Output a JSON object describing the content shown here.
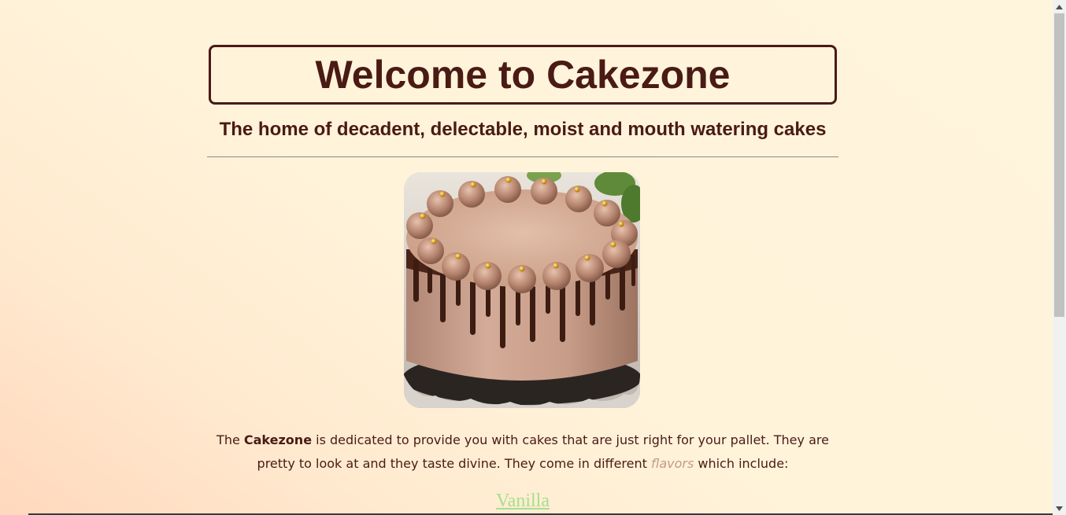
{
  "header": {
    "title": "Welcome to Cakezone",
    "subtitle": "The home of decadent, delectable, moist and mouth watering cakes"
  },
  "hero": {
    "image_alt": "Chocolate drip cake with piped frosting swirls and gold pearls"
  },
  "intro": {
    "text_1": "The ",
    "brand": "Cakezone",
    "text_2": " is dedicated to provide you with cakes that are just right for your pallet. They are pretty to look at and they taste divine. They come in different ",
    "flavors_word": "flavors",
    "text_3": " which include:"
  },
  "flavors": [
    {
      "label": "Vanilla"
    }
  ],
  "colors": {
    "primary_text": "#4a1a15",
    "link": "#a6e08e",
    "accent_italic": "#c49a8c",
    "background": "#fff5dc"
  },
  "icons": {
    "scroll_up": "triangle-up",
    "scroll_down": "triangle-down"
  }
}
